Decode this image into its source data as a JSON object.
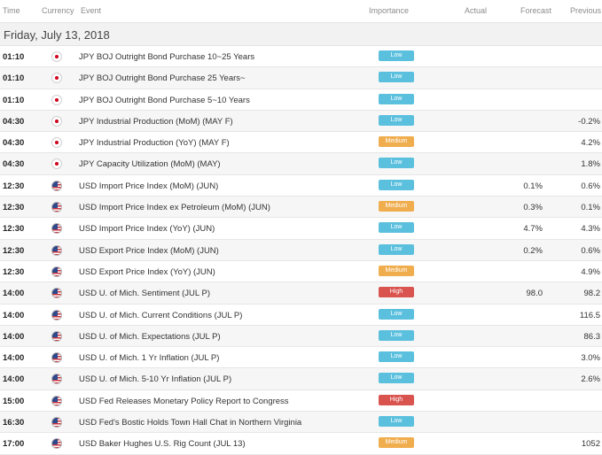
{
  "columns": {
    "time": "Time",
    "currency": "Currency",
    "event": "Event",
    "importance": "Importance",
    "actual": "Actual",
    "forecast": "Forecast",
    "previous": "Previous"
  },
  "date": "Friday, July 13, 2018",
  "colors": {
    "low": "#5bc0de",
    "medium": "#f0ad4e",
    "high": "#d9534f"
  },
  "rows": [
    {
      "time": "01:10",
      "currency": "JPY",
      "flag": "japan-flag-icon",
      "event": "JPY BOJ Outright Bond Purchase 10~25 Years",
      "importance": "Low",
      "actual": "",
      "forecast": "",
      "previous": ""
    },
    {
      "time": "01:10",
      "currency": "JPY",
      "flag": "japan-flag-icon",
      "event": "JPY BOJ Outright Bond Purchase 25 Years~",
      "importance": "Low",
      "actual": "",
      "forecast": "",
      "previous": ""
    },
    {
      "time": "01:10",
      "currency": "JPY",
      "flag": "japan-flag-icon",
      "event": "JPY BOJ Outright Bond Purchase 5~10 Years",
      "importance": "Low",
      "actual": "",
      "forecast": "",
      "previous": ""
    },
    {
      "time": "04:30",
      "currency": "JPY",
      "flag": "japan-flag-icon",
      "event": "JPY Industrial Production (MoM) (MAY F)",
      "importance": "Low",
      "actual": "",
      "forecast": "",
      "previous": "-0.2%"
    },
    {
      "time": "04:30",
      "currency": "JPY",
      "flag": "japan-flag-icon",
      "event": "JPY Industrial Production (YoY) (MAY F)",
      "importance": "Medium",
      "actual": "",
      "forecast": "",
      "previous": "4.2%"
    },
    {
      "time": "04:30",
      "currency": "JPY",
      "flag": "japan-flag-icon",
      "event": "JPY Capacity Utilization (MoM) (MAY)",
      "importance": "Low",
      "actual": "",
      "forecast": "",
      "previous": "1.8%"
    },
    {
      "time": "12:30",
      "currency": "USD",
      "flag": "us-flag-icon",
      "event": "USD Import Price Index (MoM) (JUN)",
      "importance": "Low",
      "actual": "",
      "forecast": "0.1%",
      "previous": "0.6%"
    },
    {
      "time": "12:30",
      "currency": "USD",
      "flag": "us-flag-icon",
      "event": "USD Import Price Index ex Petroleum (MoM) (JUN)",
      "importance": "Medium",
      "actual": "",
      "forecast": "0.3%",
      "previous": "0.1%"
    },
    {
      "time": "12:30",
      "currency": "USD",
      "flag": "us-flag-icon",
      "event": "USD Import Price Index (YoY) (JUN)",
      "importance": "Low",
      "actual": "",
      "forecast": "4.7%",
      "previous": "4.3%"
    },
    {
      "time": "12:30",
      "currency": "USD",
      "flag": "us-flag-icon",
      "event": "USD Export Price Index (MoM) (JUN)",
      "importance": "Low",
      "actual": "",
      "forecast": "0.2%",
      "previous": "0.6%"
    },
    {
      "time": "12:30",
      "currency": "USD",
      "flag": "us-flag-icon",
      "event": "USD Export Price Index (YoY) (JUN)",
      "importance": "Medium",
      "actual": "",
      "forecast": "",
      "previous": "4.9%"
    },
    {
      "time": "14:00",
      "currency": "USD",
      "flag": "us-flag-icon",
      "event": "USD U. of Mich. Sentiment (JUL P)",
      "importance": "High",
      "actual": "",
      "forecast": "98.0",
      "previous": "98.2"
    },
    {
      "time": "14:00",
      "currency": "USD",
      "flag": "us-flag-icon",
      "event": "USD U. of Mich. Current Conditions (JUL P)",
      "importance": "Low",
      "actual": "",
      "forecast": "",
      "previous": "116.5"
    },
    {
      "time": "14:00",
      "currency": "USD",
      "flag": "us-flag-icon",
      "event": "USD U. of Mich. Expectations (JUL P)",
      "importance": "Low",
      "actual": "",
      "forecast": "",
      "previous": "86.3"
    },
    {
      "time": "14:00",
      "currency": "USD",
      "flag": "us-flag-icon",
      "event": "USD U. of Mich. 1 Yr Inflation (JUL P)",
      "importance": "Low",
      "actual": "",
      "forecast": "",
      "previous": "3.0%"
    },
    {
      "time": "14:00",
      "currency": "USD",
      "flag": "us-flag-icon",
      "event": "USD U. of Mich. 5-10 Yr Inflation (JUL P)",
      "importance": "Low",
      "actual": "",
      "forecast": "",
      "previous": "2.6%"
    },
    {
      "time": "15:00",
      "currency": "USD",
      "flag": "us-flag-icon",
      "event": "USD Fed Releases Monetary Policy Report to Congress",
      "importance": "High",
      "actual": "",
      "forecast": "",
      "previous": ""
    },
    {
      "time": "16:30",
      "currency": "USD",
      "flag": "us-flag-icon",
      "event": "USD Fed's Bostic Holds Town Hall Chat in Northern Virginia",
      "importance": "Low",
      "actual": "",
      "forecast": "",
      "previous": ""
    },
    {
      "time": "17:00",
      "currency": "USD",
      "flag": "us-flag-icon",
      "event": "USD Baker Hughes U.S. Rig Count (JUL 13)",
      "importance": "Medium",
      "actual": "",
      "forecast": "",
      "previous": "1052"
    }
  ]
}
